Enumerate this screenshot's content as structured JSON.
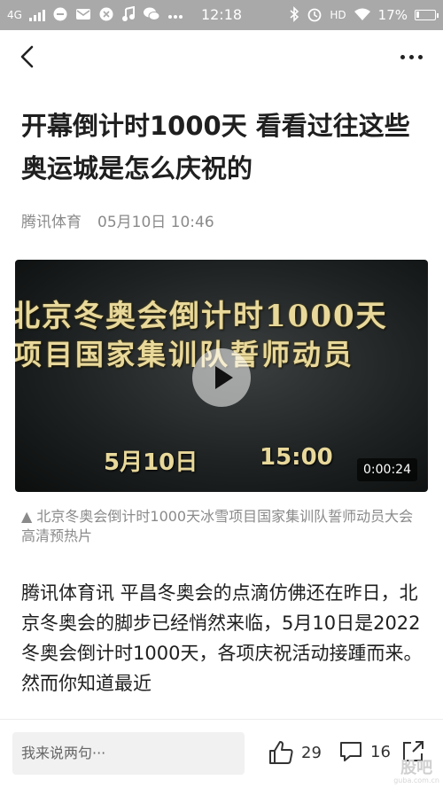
{
  "status_bar": {
    "network": "4G",
    "time": "12:18",
    "hd": "HD",
    "battery": "17%",
    "battery_level": 0.17
  },
  "article": {
    "title": "开幕倒计时1000天 看看过往这些奥运城是怎么庆祝的",
    "source": "腾讯体育",
    "datetime": "05月10日 10:46"
  },
  "video": {
    "overlay_line1": "北京冬奥会倒计时1000天",
    "overlay_line2": "项目国家集训队誓师动员",
    "overlay_date": "5月10日",
    "overlay_time": "15:00",
    "duration": "0:00:24",
    "caption": "▲ 北京冬奥会倒计时1000天冰雪项目国家集训队誓师动员大会 高清预热片"
  },
  "body": {
    "text": "腾讯体育讯 平昌冬奥会的点滴仿佛还在昨日，北京冬奥会的脚步已经悄然来临，5月10日是2022冬奥会倒计时1000天，各项庆祝活动接踵而来。然而你知道最近"
  },
  "bottom_bar": {
    "comment_placeholder": "我来说两句···",
    "likes": "29",
    "comments": "16"
  },
  "watermark": {
    "line1": "股吧",
    "line2": "guba.com.cn"
  }
}
